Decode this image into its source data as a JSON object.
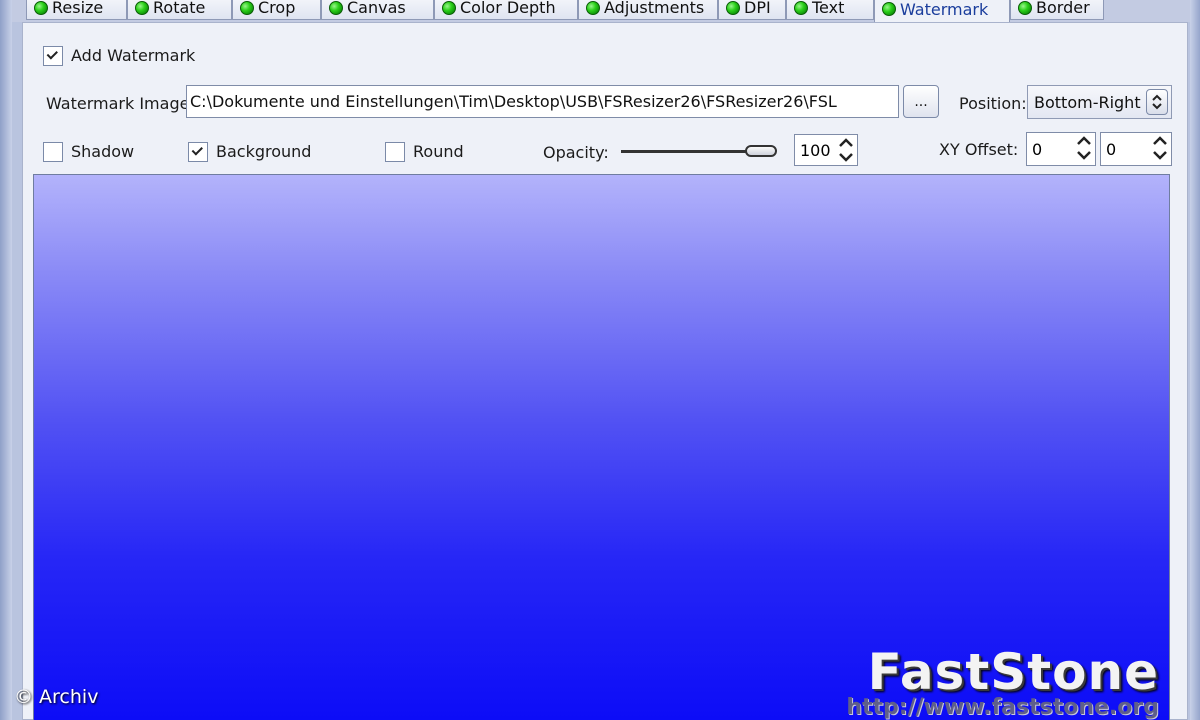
{
  "tabs": [
    {
      "label": "Resize"
    },
    {
      "label": "Rotate"
    },
    {
      "label": "Crop"
    },
    {
      "label": "Canvas"
    },
    {
      "label": "Color Depth"
    },
    {
      "label": "Adjustments"
    },
    {
      "label": "DPI"
    },
    {
      "label": "Text"
    },
    {
      "label": "Watermark",
      "active": true
    },
    {
      "label": "Border"
    }
  ],
  "watermark": {
    "add_label": "Add Watermark",
    "add_checked": true,
    "image_label": "Watermark Image:",
    "image_path": "C:\\Dokumente und Einstellungen\\Tim\\Desktop\\USB\\FSResizer26\\FSResizer26\\FSL",
    "browse_label": "...",
    "position_label": "Position:",
    "position_value": "Bottom-Right",
    "shadow_label": "Shadow",
    "shadow_checked": false,
    "background_label": "Background",
    "background_checked": true,
    "round_label": "Round",
    "round_checked": false,
    "opacity_label": "Opacity:",
    "opacity_value": "100",
    "opacity_percent": 100,
    "xy_offset_label": "XY Offset:",
    "x_offset": "0",
    "y_offset": "0"
  },
  "preview": {
    "watermark_title": "FastStone",
    "watermark_url": "http://www.faststone.org"
  },
  "credit": "© Archiv",
  "colors": {
    "active_tab_text": "#1a3d9c",
    "status_dot": "#2bd01a",
    "preview_top": "#b3b3fb",
    "preview_bottom": "#0c0cf7"
  },
  "icons": {
    "tab_status": "green-dot-icon",
    "check": "checkmark-icon",
    "spinner": "up-down-arrows-icon",
    "dropdown": "up-down-arrows-icon"
  }
}
